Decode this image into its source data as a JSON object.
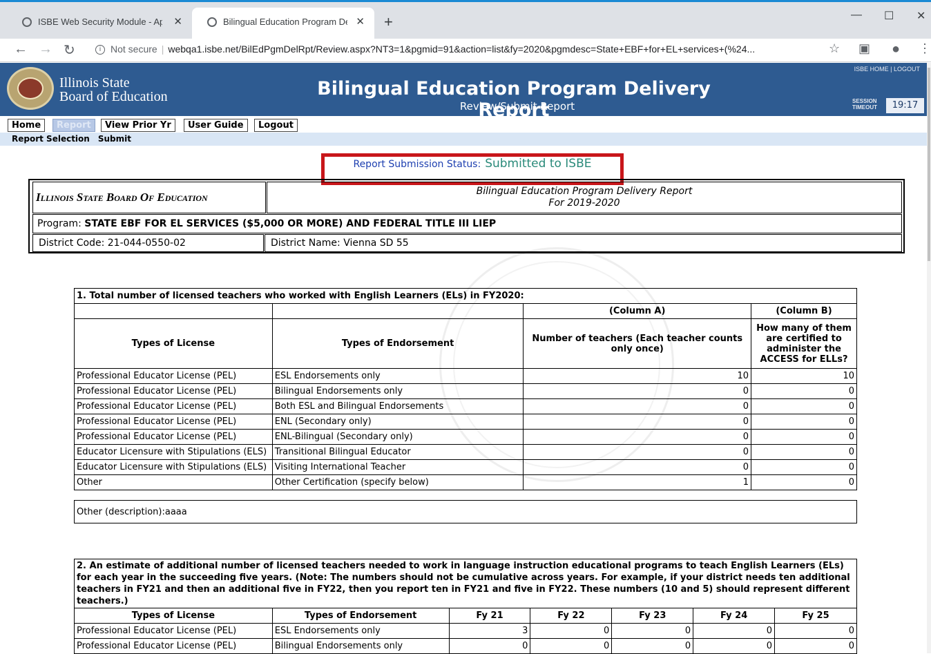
{
  "browser": {
    "tabs": [
      {
        "label": "ISBE Web Security Module - Appl",
        "close": "✕"
      },
      {
        "label": "Bilingual Education Program Deli",
        "close": "✕"
      }
    ],
    "new_tab": "+",
    "address": {
      "security": "Not secure",
      "url": "webqa1.isbe.net/BilEdPgmDelRpt/Review.aspx?NT3=1&pgmid=91&action=list&fy=2020&pgmdesc=State+EBF+for+EL+services+(%24..."
    }
  },
  "app": {
    "agency_line1": "Illinois State",
    "agency_line2": "Board of Education",
    "title": "Bilingual Education Program Delivery Report",
    "subtitle": "Review/Submit Report",
    "top_links": "ISBE HOME  |  LOGOUT",
    "session_label_1": "SESSION",
    "session_label_2": "TIMEOUT",
    "session_time": "19:17"
  },
  "menu": {
    "home": "Home",
    "report": "Report",
    "view_prior": "View Prior Yr",
    "user_guide": "User Guide",
    "logout": "Logout"
  },
  "subnav": {
    "report_selection": "Report Selection",
    "submit": "Submit"
  },
  "status": {
    "label": "Report Submission Status:",
    "value": "Submitted to ISBE"
  },
  "header": {
    "isbe": "Illinois State Board Of Education",
    "report_title": "Bilingual Education Program Delivery Report",
    "report_year": "For 2019-2020",
    "program_label": "Program:",
    "program_value": "STATE EBF FOR EL SERVICES ($5,000 OR MORE) AND FEDERAL TITLE III LIEP",
    "district_code_label": "District Code:",
    "district_code": "21-044-0550-02",
    "district_name_label": "District Name:",
    "district_name": "Vienna SD 55"
  },
  "section1": {
    "caption": "1. Total number of licensed teachers who worked with English Learners (ELs) in FY2020:",
    "col_a": "(Column A)",
    "col_b": "(Column B)",
    "h_license": "Types of License",
    "h_endorse": "Types of Endorsement",
    "h_count": "Number of teachers (Each teacher counts only once)",
    "h_access": "How many of them are certified to administer the ACCESS for ELLs?",
    "rows": [
      {
        "license": "Professional Educator License (PEL)",
        "endorsement": "ESL Endorsements only",
        "a": "10",
        "b": "10"
      },
      {
        "license": "Professional Educator License (PEL)",
        "endorsement": "Bilingual Endorsements only",
        "a": "0",
        "b": "0"
      },
      {
        "license": "Professional Educator License (PEL)",
        "endorsement": "Both ESL and Bilingual Endorsements",
        "a": "0",
        "b": "0"
      },
      {
        "license": "Professional Educator License (PEL)",
        "endorsement": "ENL (Secondary only)",
        "a": "0",
        "b": "0"
      },
      {
        "license": "Professional Educator License (PEL)",
        "endorsement": "ENL-Bilingual (Secondary only)",
        "a": "0",
        "b": "0"
      },
      {
        "license": "Educator Licensure with Stipulations (ELS)",
        "endorsement": "Transitional Bilingual Educator",
        "a": "0",
        "b": "0"
      },
      {
        "license": "Educator Licensure with Stipulations (ELS)",
        "endorsement": "Visiting International Teacher",
        "a": "0",
        "b": "0"
      },
      {
        "license": "Other",
        "endorsement": "Other Certification (specify below)",
        "a": "1",
        "b": "0"
      }
    ],
    "other_label": "Other (description):",
    "other_value": "aaaa"
  },
  "section2": {
    "caption": "2. An estimate of additional number of licensed teachers needed to work in language instruction educational programs to teach English Learners (ELs) for each year in the succeeding five years. (Note: The numbers should not be cumulative across years. For example, if your district needs ten additional teachers in FY21 and then an additional five in FY22, then you report ten in FY21 and five in FY22. These numbers (10 and 5) should represent different teachers.)",
    "h_license": "Types of License",
    "h_endorse": "Types of Endorsement",
    "years": [
      "Fy 21",
      "Fy 22",
      "Fy 23",
      "Fy 24",
      "Fy 25"
    ],
    "rows": [
      {
        "license": "Professional Educator License (PEL)",
        "endorsement": "ESL Endorsements only",
        "v": [
          "3",
          "0",
          "0",
          "0",
          "0"
        ]
      },
      {
        "license": "Professional Educator License (PEL)",
        "endorsement": "Bilingual Endorsements only",
        "v": [
          "0",
          "0",
          "0",
          "0",
          "0"
        ]
      }
    ]
  }
}
